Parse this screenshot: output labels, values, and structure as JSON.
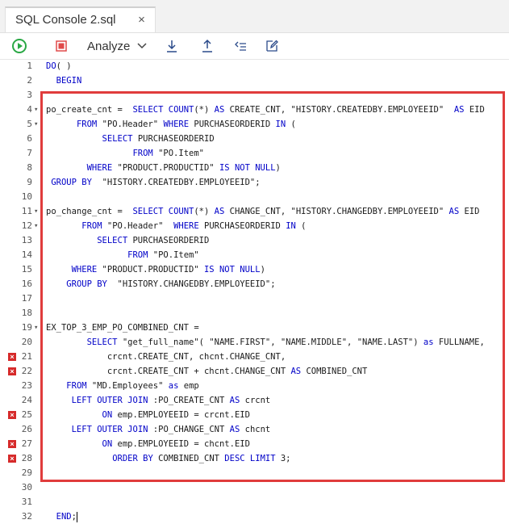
{
  "tab": {
    "title": "SQL Console 2.sql",
    "close": "×"
  },
  "toolbar": {
    "analyze_label": "Analyze"
  },
  "colors": {
    "keyword": "#0000c8",
    "error": "#d62a2a",
    "highlight": "#e03c3c",
    "run": "#2aa845",
    "stop": "#e04a4a"
  },
  "lines": [
    {
      "n": "1",
      "fold": false,
      "err": false,
      "text": "DO( )"
    },
    {
      "n": "2",
      "fold": false,
      "err": false,
      "text": "  BEGIN"
    },
    {
      "n": "3",
      "fold": false,
      "err": false,
      "text": ""
    },
    {
      "n": "4",
      "fold": true,
      "err": false,
      "text": "po_create_cnt =  SELECT COUNT(*) AS CREATE_CNT, \"HISTORY.CREATEDBY.EMPLOYEEID\"  AS EID"
    },
    {
      "n": "5",
      "fold": true,
      "err": false,
      "text": "      FROM \"PO.Header\" WHERE PURCHASEORDERID IN ("
    },
    {
      "n": "6",
      "fold": false,
      "err": false,
      "text": "           SELECT PURCHASEORDERID"
    },
    {
      "n": "7",
      "fold": false,
      "err": false,
      "text": "                 FROM \"PO.Item\""
    },
    {
      "n": "8",
      "fold": false,
      "err": false,
      "text": "        WHERE \"PRODUCT.PRODUCTID\" IS NOT NULL)"
    },
    {
      "n": "9",
      "fold": false,
      "err": false,
      "text": " GROUP BY  \"HISTORY.CREATEDBY.EMPLOYEEID\";"
    },
    {
      "n": "10",
      "fold": false,
      "err": false,
      "text": ""
    },
    {
      "n": "11",
      "fold": true,
      "err": false,
      "text": "po_change_cnt =  SELECT COUNT(*) AS CHANGE_CNT, \"HISTORY.CHANGEDBY.EMPLOYEEID\" AS EID"
    },
    {
      "n": "12",
      "fold": true,
      "err": false,
      "text": "       FROM \"PO.Header\"  WHERE PURCHASEORDERID IN ("
    },
    {
      "n": "13",
      "fold": false,
      "err": false,
      "text": "          SELECT PURCHASEORDERID"
    },
    {
      "n": "14",
      "fold": false,
      "err": false,
      "text": "                FROM \"PO.Item\""
    },
    {
      "n": "15",
      "fold": false,
      "err": false,
      "text": "     WHERE \"PRODUCT.PRODUCTID\" IS NOT NULL)"
    },
    {
      "n": "16",
      "fold": false,
      "err": false,
      "text": "    GROUP BY  \"HISTORY.CHANGEDBY.EMPLOYEEID\";"
    },
    {
      "n": "17",
      "fold": false,
      "err": false,
      "text": ""
    },
    {
      "n": "18",
      "fold": false,
      "err": false,
      "text": ""
    },
    {
      "n": "19",
      "fold": true,
      "err": false,
      "text": "EX_TOP_3_EMP_PO_COMBINED_CNT ="
    },
    {
      "n": "20",
      "fold": false,
      "err": false,
      "text": "        SELECT \"get_full_name\"( \"NAME.FIRST\", \"NAME.MIDDLE\", \"NAME.LAST\") as FULLNAME,"
    },
    {
      "n": "21",
      "fold": false,
      "err": true,
      "text": "            crcnt.CREATE_CNT, chcnt.CHANGE_CNT,"
    },
    {
      "n": "22",
      "fold": false,
      "err": true,
      "text": "            crcnt.CREATE_CNT + chcnt.CHANGE_CNT AS COMBINED_CNT"
    },
    {
      "n": "23",
      "fold": false,
      "err": false,
      "text": "    FROM \"MD.Employees\" as emp"
    },
    {
      "n": "24",
      "fold": false,
      "err": false,
      "text": "     LEFT OUTER JOIN :PO_CREATE_CNT AS crcnt"
    },
    {
      "n": "25",
      "fold": false,
      "err": true,
      "text": "           ON emp.EMPLOYEEID = crcnt.EID"
    },
    {
      "n": "26",
      "fold": false,
      "err": false,
      "text": "     LEFT OUTER JOIN :PO_CHANGE_CNT AS chcnt"
    },
    {
      "n": "27",
      "fold": false,
      "err": true,
      "text": "           ON emp.EMPLOYEEID = chcnt.EID"
    },
    {
      "n": "28",
      "fold": false,
      "err": true,
      "text": "             ORDER BY COMBINED_CNT DESC LIMIT 3;"
    },
    {
      "n": "29",
      "fold": false,
      "err": false,
      "text": ""
    },
    {
      "n": "30",
      "fold": false,
      "err": false,
      "text": ""
    },
    {
      "n": "31",
      "fold": false,
      "err": false,
      "text": ""
    },
    {
      "n": "32",
      "fold": false,
      "err": false,
      "text": "  END;"
    }
  ]
}
